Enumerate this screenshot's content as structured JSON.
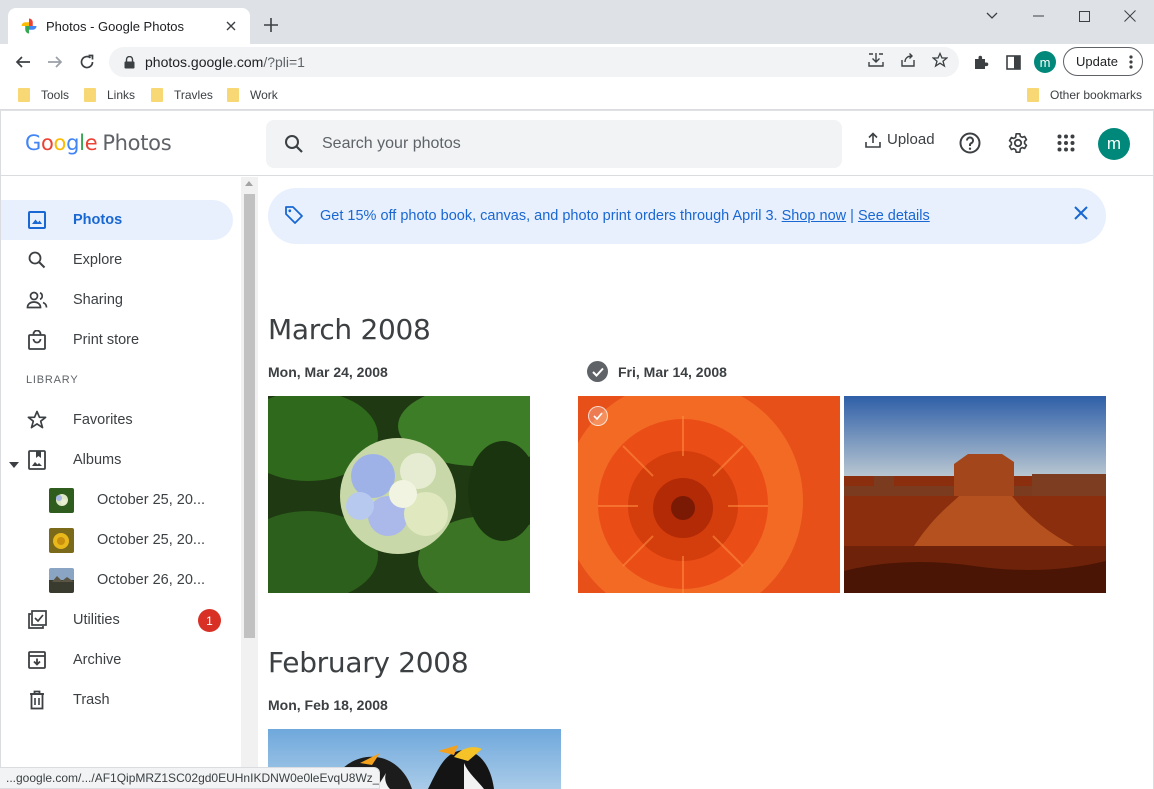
{
  "browser": {
    "tab_title": "Photos - Google Photos",
    "url_main": "photos.google.com",
    "url_rest": "/?pli=1",
    "profile_initial": "m",
    "update_label": "Update",
    "bookmarks": [
      "Tools",
      "Links",
      "Travles",
      "Work"
    ],
    "other_bookmarks": "Other bookmarks",
    "status_url": "...google.com/.../AF1QipMRZ1SC02gd0EUHnIKDNW0e0leEvqU8Wz_..."
  },
  "header": {
    "logo_word": "Google",
    "logo_product": "Photos",
    "search_placeholder": "Search your photos",
    "upload_label": "Upload",
    "avatar_initial": "m"
  },
  "sidebar": {
    "items": [
      {
        "label": "Photos",
        "icon": "photo-icon",
        "active": true
      },
      {
        "label": "Explore",
        "icon": "search-icon"
      },
      {
        "label": "Sharing",
        "icon": "people-icon"
      },
      {
        "label": "Print store",
        "icon": "shopping-bag-icon"
      }
    ],
    "library_heading": "LIBRARY",
    "library": [
      {
        "label": "Favorites",
        "icon": "star-icon"
      },
      {
        "label": "Albums",
        "icon": "album-icon"
      }
    ],
    "albums": [
      {
        "label": "October 25, 20..."
      },
      {
        "label": "October 25, 20..."
      },
      {
        "label": "October 26, 20..."
      }
    ],
    "bottom": [
      {
        "label": "Utilities",
        "icon": "utilities-icon",
        "badge": "1"
      },
      {
        "label": "Archive",
        "icon": "archive-icon"
      },
      {
        "label": "Trash",
        "icon": "trash-icon"
      }
    ]
  },
  "promo": {
    "text": "Get 15% off photo book, canvas, and photo print orders through April 3.",
    "shop_link": "Shop now",
    "separator": "|",
    "details_link": "See details"
  },
  "sections": [
    {
      "month": "March 2008",
      "days": [
        {
          "date": "Mon, Mar 24, 2008",
          "photos": [
            "hydrangea"
          ]
        },
        {
          "date": "Fri, Mar 14, 2008",
          "selected": true,
          "photos": [
            "chrysanthemum",
            "desert"
          ]
        }
      ]
    },
    {
      "month": "February 2008",
      "days": [
        {
          "date": "Mon, Feb 18, 2008",
          "photos": [
            "penguins"
          ]
        }
      ]
    }
  ],
  "colors": {
    "accent": "#1967d2",
    "active_bg": "#e8f0fe",
    "avatar": "#00897b",
    "badge": "#d93025"
  }
}
